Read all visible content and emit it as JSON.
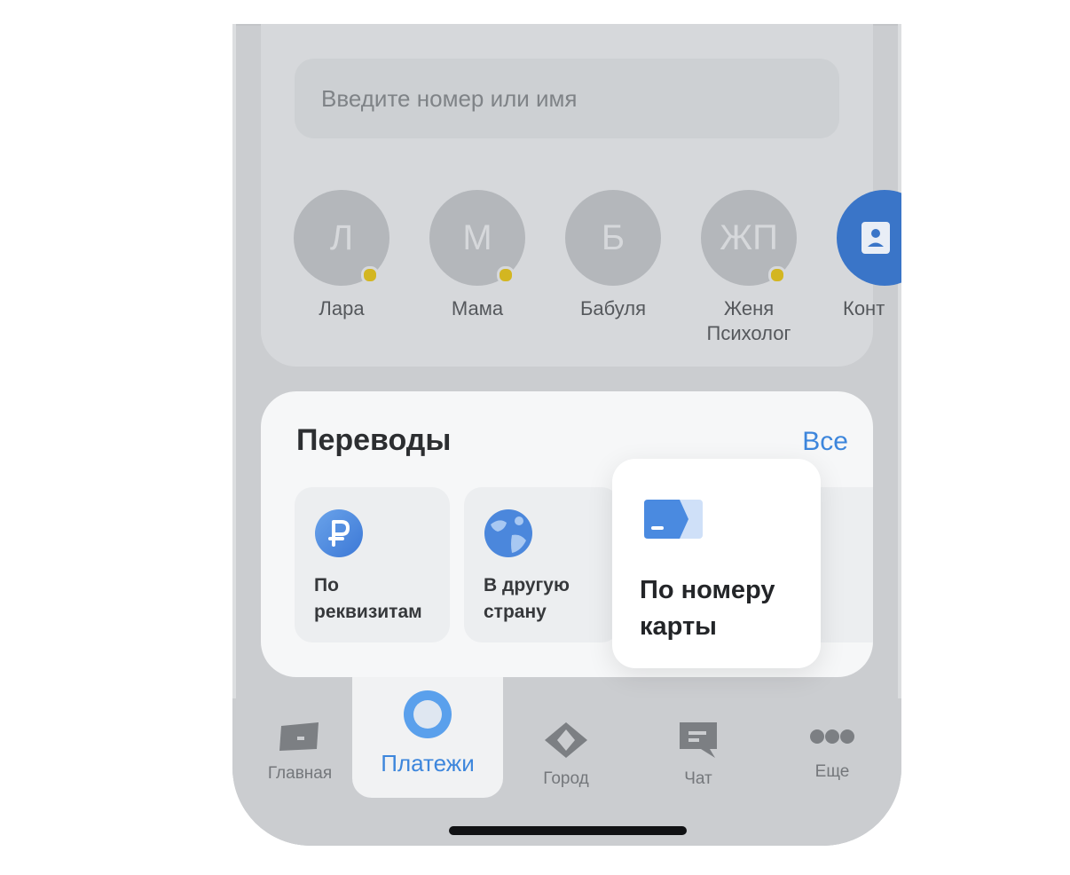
{
  "search": {
    "placeholder": "Введите номер или имя"
  },
  "contacts": [
    {
      "initials": "Л",
      "name": "Лара",
      "has_dot": true
    },
    {
      "initials": "М",
      "name": "Мама",
      "has_dot": true
    },
    {
      "initials": "Б",
      "name": "Бабуля",
      "has_dot": false
    },
    {
      "initials": "ЖП",
      "name": "Женя\nПсихолог",
      "has_dot": true
    },
    {
      "initials": "",
      "name": "Конт",
      "has_dot": false
    }
  ],
  "transfers": {
    "title": "Переводы",
    "all_link": "Все",
    "tiles": [
      {
        "label": "По\nреквизитам",
        "icon": "ruble-icon"
      },
      {
        "label": "В другую\nстрану",
        "icon": "globe-icon"
      },
      {
        "label": "По номеру\nкарты",
        "icon": "card-icon"
      }
    ]
  },
  "tabs": [
    {
      "label": "Главная",
      "icon": "card-icon"
    },
    {
      "label": "Платежи",
      "icon": "payments-circle-icon",
      "active": true
    },
    {
      "label": "Город",
      "icon": "city-diamond-icon"
    },
    {
      "label": "Чат",
      "icon": "chat-icon"
    },
    {
      "label": "Еще",
      "icon": "more-dots-icon"
    }
  ],
  "colors": {
    "accent_blue": "#3d86dc",
    "badge_yellow": "#d3b621",
    "dim_background": "#cbcdd0"
  }
}
